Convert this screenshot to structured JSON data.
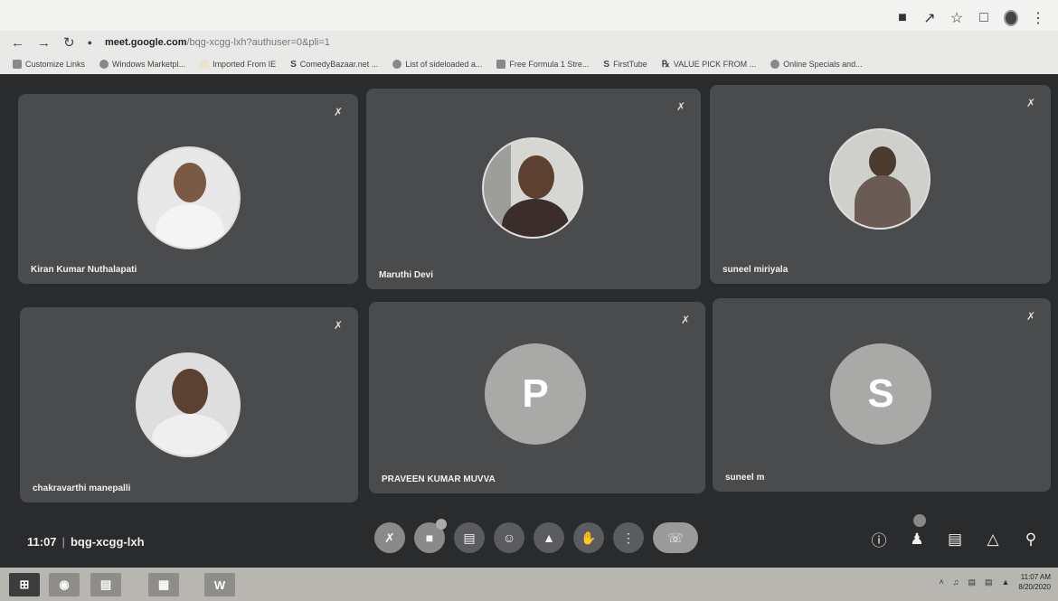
{
  "browser": {
    "url_host": "meet.google.com",
    "url_path": "/bqg-xcgg-lxh?authuser=0&pli=1",
    "bookmarks": [
      "Customize Links",
      "Windows Marketpl...",
      "Imported From IE",
      "ComedyBazaar.net ...",
      "List of sideloaded a...",
      "Free Formula 1 Stre...",
      "FirstTube",
      "VALUE PICK FROM ...",
      "Online Specials and..."
    ]
  },
  "participants": [
    {
      "name": "Kiran Kumar Nuthalapati",
      "avatar": "photo",
      "mic": "muted"
    },
    {
      "name": "Maruthi Devi",
      "avatar": "photo",
      "mic": "muted"
    },
    {
      "name": "suneel miriyala",
      "avatar": "photo",
      "mic": "muted"
    },
    {
      "name": "chakravarthi manepalli",
      "avatar": "photo",
      "mic": "muted"
    },
    {
      "name": "PRAVEEN KUMAR MUVVA",
      "avatar": "letter",
      "letter": "P",
      "mic": "muted"
    },
    {
      "name": "suneel m",
      "avatar": "letter",
      "letter": "S",
      "mic": "muted"
    }
  ],
  "meeting": {
    "time": "11:07",
    "code": "bqg-xcgg-lxh"
  },
  "taskbar": {
    "clock_time": "11:07 AM",
    "clock_date": "8/20/2020"
  },
  "colors": {
    "meet_bg": "#2a2b2d",
    "tile_bg": "#4a4b4d",
    "letter_avatar": "#a9a9a7"
  }
}
